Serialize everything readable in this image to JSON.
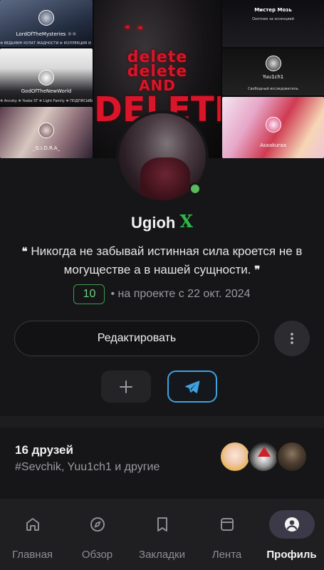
{
  "banner": {
    "tiles": [
      {
        "caption": "LordOfTheMysteries ☼☼",
        "sub": "❄ ВЕДЬМИН КУЛАТ ЖАДНОСТИ ❄ КОЛЛЕКЦИЯ И ЛЕСТЬ ❄"
      },
      {
        "caption": "GodOfTheNewWorld",
        "sub": "❄ Ancoky ❄ Yoake ST ❄ Light Family ❄ ПОДПИСЫВАЙТЕСЬ НА МОЙ КАНАЛ ❄"
      },
      {
        "caption": "_G.I.D.R.A_",
        "sub": ""
      },
      {
        "caption": "",
        "sub": ""
      },
      {
        "caption": "Мистер Мозь",
        "sub": "Охотник за эссенцией"
      },
      {
        "caption": "Yuu1ch1",
        "sub": "Свободный исследователь"
      },
      {
        "caption": "Asaakuraa",
        "sub": ""
      }
    ],
    "center_words": [
      "delete",
      "delete",
      "AND",
      "DELETE"
    ]
  },
  "profile": {
    "name": "Ugioh",
    "name_badge": "X",
    "bio_open_quote": "❝",
    "bio_text": "Никогда не забывай истинная сила кроется не в могуществе а в нашей сущности.",
    "bio_close_quote": "❞",
    "level": "10",
    "since": "• на проекте с 22 окт. 2024",
    "online": true,
    "status_color": "#5cb85c"
  },
  "actions": {
    "edit_label": "Редактировать",
    "more_icon": "more-vertical-icon",
    "add_icon": "plus-icon",
    "telegram_icon": "telegram-icon",
    "telegram_color": "#3fa1e0"
  },
  "friends": {
    "title": "16 друзей",
    "subtitle": "#Sevchik, Yuu1ch1 и другие"
  },
  "nav": {
    "items": [
      {
        "label": "Главная",
        "icon": "home-icon"
      },
      {
        "label": "Обзор",
        "icon": "compass-icon"
      },
      {
        "label": "Закладки",
        "icon": "bookmark-icon"
      },
      {
        "label": "Лента",
        "icon": "feed-icon"
      },
      {
        "label": "Профиль",
        "icon": "profile-icon",
        "active": true
      }
    ]
  }
}
